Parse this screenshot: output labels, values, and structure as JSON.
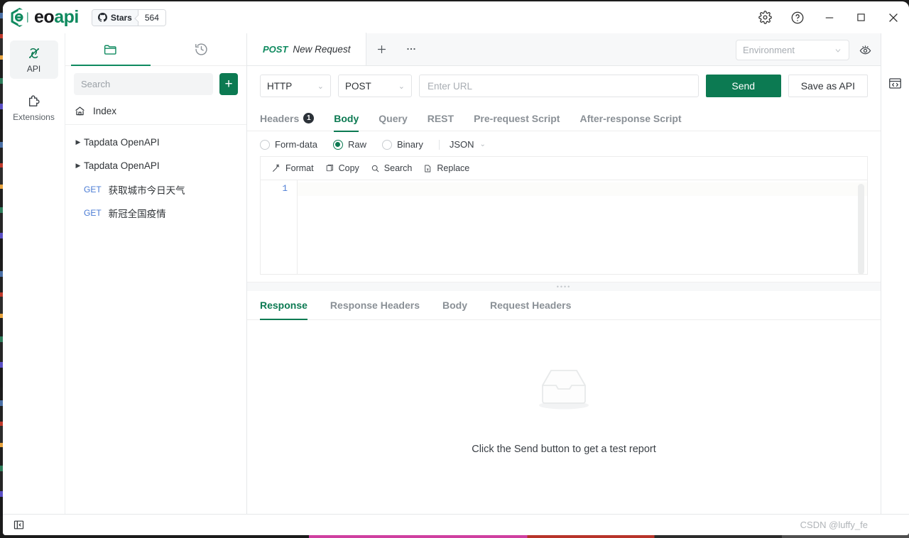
{
  "app": {
    "logo_eo": "eo",
    "logo_api": "api",
    "stars_label": "Stars",
    "stars_count": "564",
    "accent_color": "#0c7a52",
    "logo_green": "#0f8a5f"
  },
  "titlebar": {
    "settings_icon": "gear-icon",
    "help_icon": "question-circle-icon",
    "minimize_icon": "minimize-icon",
    "maximize_icon": "maximize-icon",
    "close_icon": "close-icon"
  },
  "activity_bar": {
    "items": [
      {
        "label": "API",
        "icon": "api-helix-icon",
        "active": true
      },
      {
        "label": "Extensions",
        "icon": "puzzle-piece-icon",
        "active": false
      }
    ]
  },
  "sidebar": {
    "tabs": [
      {
        "icon": "folder-icon",
        "name": "collections-tab",
        "active": true
      },
      {
        "icon": "history-clock-icon",
        "name": "history-tab",
        "active": false
      }
    ],
    "search": {
      "placeholder": "Search",
      "value": ""
    },
    "add_button_label": "+",
    "index_label": "Index",
    "index_icon": "home-icon",
    "tree": [
      {
        "type": "group",
        "label": "Tapdata OpenAPI",
        "expanded": false
      },
      {
        "type": "group",
        "label": "Tapdata OpenAPI",
        "expanded": false
      },
      {
        "type": "request",
        "method": "GET",
        "label": "获取城市今日天气"
      },
      {
        "type": "request",
        "method": "GET",
        "label": "新冠全国疫情"
      }
    ]
  },
  "tabs_bar": {
    "open_tabs": [
      {
        "method": "POST",
        "title": "New Request",
        "active": true
      }
    ],
    "new_tab_icon": "plus-icon",
    "more_tabs_icon": "ellipsis-icon",
    "environment": {
      "placeholder": "Environment",
      "value": ""
    },
    "eye_icon": "eye-icon"
  },
  "request": {
    "protocol": "HTTP",
    "method": "POST",
    "url": {
      "placeholder": "Enter URL",
      "value": ""
    },
    "send_label": "Send",
    "save_label": "Save as API",
    "tabs": [
      {
        "label": "Headers",
        "badge": "1",
        "active": false
      },
      {
        "label": "Body",
        "badge": "",
        "active": true
      },
      {
        "label": "Query",
        "badge": "",
        "active": false
      },
      {
        "label": "REST",
        "badge": "",
        "active": false
      },
      {
        "label": "Pre-request Script",
        "badge": "",
        "active": false
      },
      {
        "label": "After-response Script",
        "badge": "",
        "active": false
      }
    ],
    "body_options": [
      {
        "label": "Form-data",
        "checked": false
      },
      {
        "label": "Raw",
        "checked": true
      },
      {
        "label": "Binary",
        "checked": false
      }
    ],
    "body_format": "JSON",
    "editor_tools": [
      {
        "label": "Format",
        "icon": "magic-wand-icon"
      },
      {
        "label": "Copy",
        "icon": "copy-icon"
      },
      {
        "label": "Search",
        "icon": "search-icon"
      },
      {
        "label": "Replace",
        "icon": "replace-icon"
      }
    ],
    "editor_lines": [
      "1"
    ],
    "editor_content": ""
  },
  "response": {
    "tabs": [
      {
        "label": "Response",
        "active": true
      },
      {
        "label": "Response Headers",
        "active": false
      },
      {
        "label": "Body",
        "active": false
      },
      {
        "label": "Request Headers",
        "active": false
      }
    ],
    "empty_icon": "empty-inbox-icon",
    "empty_text": "Click the Send button to get a test report"
  },
  "right_rail": {
    "items": [
      {
        "icon": "code-snippet-icon",
        "name": "code-generate-button"
      }
    ]
  },
  "statusbar": {
    "collapse_icon": "collapse-sidebar-icon",
    "watermark": "CSDN @luffy_fe"
  }
}
